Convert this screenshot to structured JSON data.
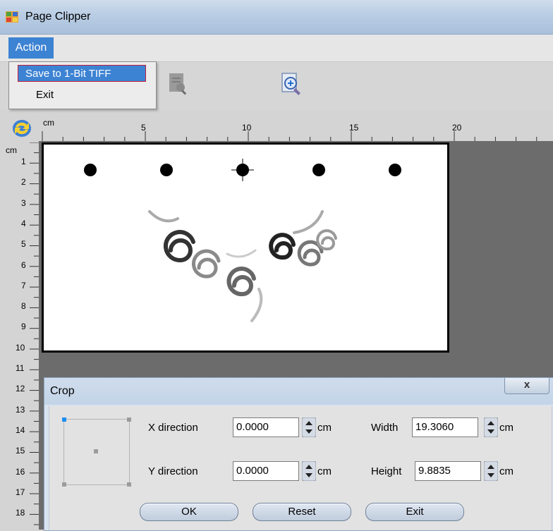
{
  "window": {
    "title": "Page Clipper"
  },
  "menu": {
    "action_label": "Action",
    "items": [
      "Save to 1-Bit TIFF",
      "Exit"
    ]
  },
  "ruler": {
    "unit": "cm",
    "top_labels": [
      "5",
      "10",
      "15",
      "20"
    ],
    "left_labels": [
      "1",
      "2",
      "3",
      "4",
      "5",
      "6",
      "7",
      "8",
      "9",
      "10",
      "11",
      "12",
      "13",
      "14",
      "15",
      "16",
      "17",
      "18"
    ]
  },
  "crop_dialog": {
    "title": "Crop",
    "close_label": "x",
    "x_direction_label": "X direction",
    "x_direction_value": "0.0000",
    "y_direction_label": "Y direction",
    "y_direction_value": "0.0000",
    "width_label": "Width",
    "width_value": "19.3060",
    "height_label": "Height",
    "height_value": "9.8835",
    "unit": "cm",
    "ok_label": "OK",
    "reset_label": "Reset",
    "exit_label": "Exit"
  },
  "icons": [
    "app-icon",
    "document-icon",
    "zoom-in-icon",
    "refresh-icon",
    "crosshair-icon"
  ],
  "colors": {
    "menu_highlight": "#3d83d3",
    "selection_border": "#c0203a"
  }
}
